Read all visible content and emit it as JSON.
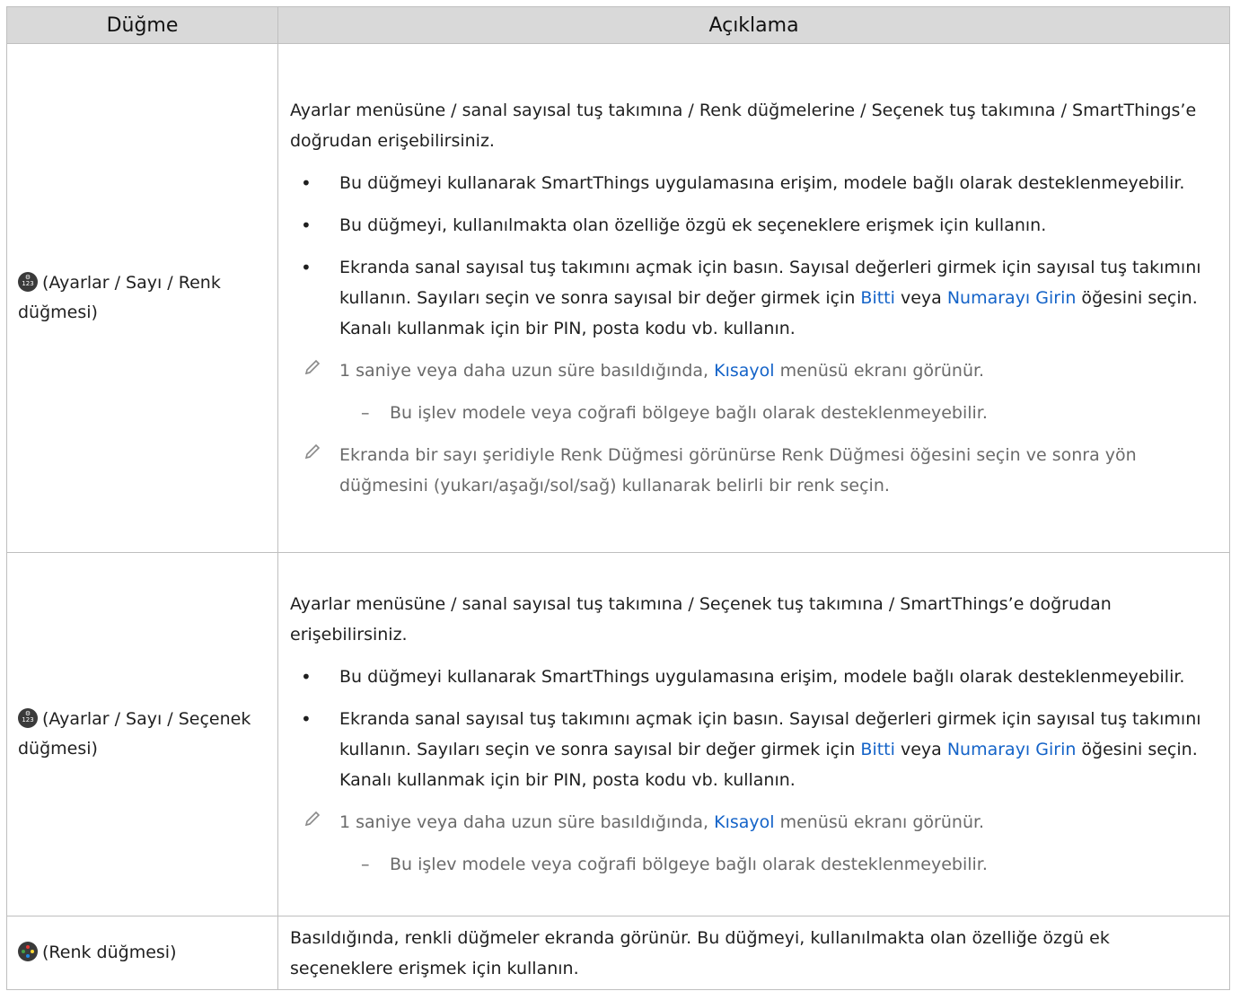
{
  "header": {
    "col1": "Düğme",
    "col2": "Açıklama"
  },
  "rows": [
    {
      "button_label": "(Ayarlar / Sayı / Renk düğmesi)",
      "icon": "settings-number-color-icon",
      "lead": "Ayarlar menüsüne / sanal sayısal tuş takımına / Renk düğmelerine / Seçenek tuş takımına / SmartThings’e doğrudan erişebilirsiniz.",
      "bullets": [
        "Bu düğmeyi kullanarak SmartThings uygulamasına erişim, modele bağlı olarak desteklenmeyebilir.",
        "Bu düğmeyi, kullanılmakta olan özelliğe özgü ek seçeneklere erişmek için kullanın."
      ],
      "bullet3": {
        "a": "Ekranda sanal sayısal tuş takımını açmak için basın. Sayısal değerleri girmek için sayısal tuş takımını kullanın. Sayıları seçin ve sonra sayısal bir değer girmek için ",
        "link1": "Bitti",
        "b": " veya ",
        "link2": "Numarayı Girin",
        "c": " öğesini seçin. Kanalı kullanmak için bir PIN, posta kodu vb. kullanın."
      },
      "note1": {
        "a": "1 saniye veya daha uzun süre basıldığında, ",
        "link": "Kısayol",
        "b": " menüsü ekranı görünür."
      },
      "sub": "Bu işlev modele veya coğrafi bölgeye bağlı olarak desteklenmeyebilir.",
      "note2": "Ekranda bir sayı şeridiyle Renk Düğmesi görünürse Renk Düğmesi öğesini seçin ve sonra yön düğmesini (yukarı/aşağı/sol/sağ) kullanarak belirli bir renk seçin."
    },
    {
      "button_label": "(Ayarlar / Sayı / Seçenek düğmesi)",
      "icon": "settings-number-option-icon",
      "lead": "Ayarlar menüsüne / sanal sayısal tuş takımına / Seçenek tuş takımına / SmartThings’e doğrudan erişebilirsiniz.",
      "bullets": [
        "Bu düğmeyi kullanarak SmartThings uygulamasına erişim, modele bağlı olarak desteklenmeyebilir."
      ],
      "bullet3": {
        "a": "Ekranda sanal sayısal tuş takımını açmak için basın. Sayısal değerleri girmek için sayısal tuş takımını kullanın. Sayıları seçin ve sonra sayısal bir değer girmek için ",
        "link1": "Bitti",
        "b": " veya ",
        "link2": "Numarayı Girin",
        "c": " öğesini seçin. Kanalı kullanmak için bir PIN, posta kodu vb. kullanın."
      },
      "note1": {
        "a": "1 saniye veya daha uzun süre basıldığında, ",
        "link": "Kısayol",
        "b": " menüsü ekranı görünür."
      },
      "sub": "Bu işlev modele veya coğrafi bölgeye bağlı olarak desteklenmeyebilir."
    },
    {
      "button_label": "(Renk düğmesi)",
      "icon": "color-button-icon",
      "lead": "Basıldığında, renkli düğmeler ekranda görünür. Bu düğmeyi, kullanılmakta olan özelliğe özgü ek seçeneklere erişmek için kullanın."
    }
  ],
  "icon_glyphs": {
    "gear": "⚙",
    "number": "123"
  },
  "colors": {
    "header_bg": "#d9d9d9",
    "link": "#1463c8",
    "note_text": "#6a6a6a",
    "icon_bg": "#3a3a3a",
    "dot_red": "#e53935",
    "dot_green": "#43a047",
    "dot_yellow": "#fdd835",
    "dot_blue": "#1e88e5"
  }
}
